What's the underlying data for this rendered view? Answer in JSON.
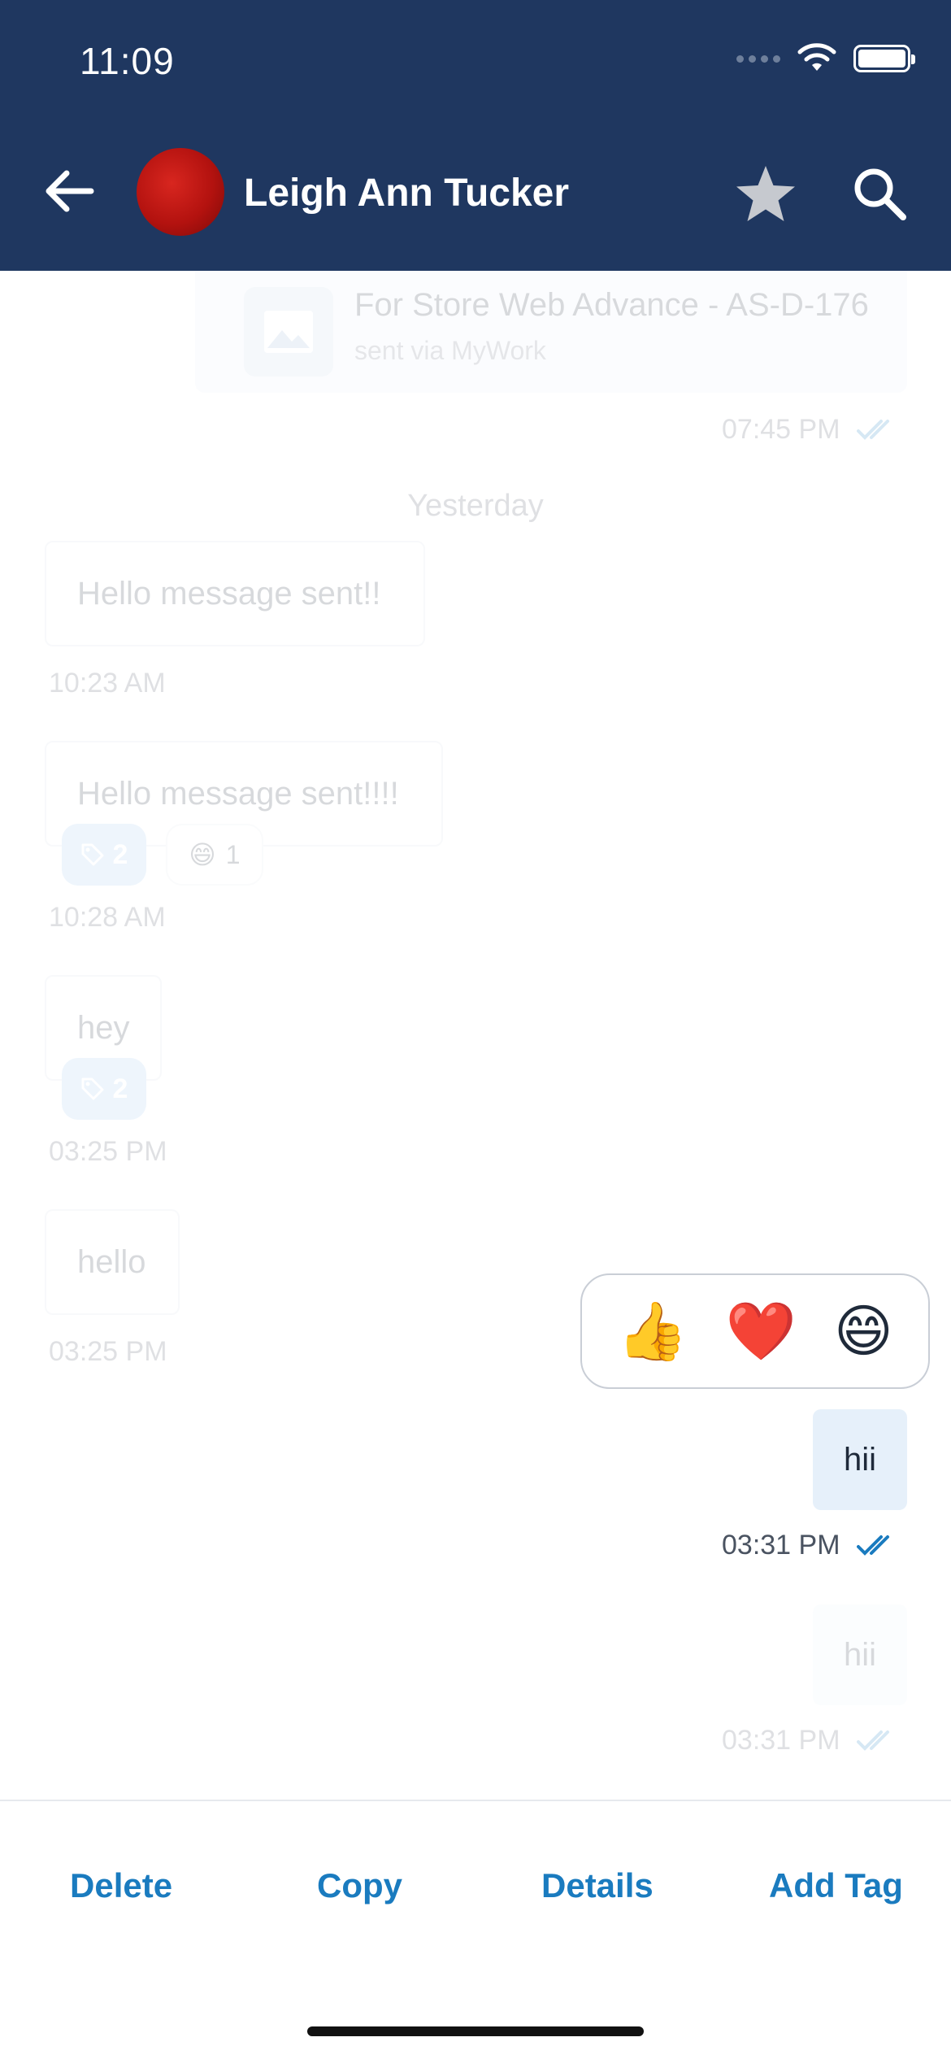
{
  "status_bar": {
    "time": "11:09"
  },
  "header": {
    "contact_name": "Leigh Ann Tucker"
  },
  "attachment": {
    "title": "For Store Web Advance - AS-D-176",
    "subtitle": "sent via MyWork",
    "time": "07:45 PM"
  },
  "date_separator": "Yesterday",
  "messages": [
    {
      "text": "Hello message sent!!",
      "time": "10:23 AM"
    },
    {
      "text": "Hello message sent!!!!",
      "time": "10:28 AM",
      "tag_count": "2",
      "reaction_emoji": "😄",
      "reaction_count": "1"
    },
    {
      "text": "hey",
      "time": "03:25 PM",
      "tag_count": "2"
    },
    {
      "text": "hello",
      "time": "03:25 PM"
    }
  ],
  "selected_message": {
    "text": "hii",
    "time": "03:31 PM"
  },
  "next_message": {
    "text": "hii",
    "time": "03:31 PM"
  },
  "reaction_picker": {
    "emojis": [
      "👍",
      "❤️",
      "😄"
    ]
  },
  "actions": {
    "delete": "Delete",
    "copy": "Copy",
    "details": "Details",
    "add_tag": "Add Tag"
  },
  "colors": {
    "header": "#1f3760",
    "action_text": "#1a7bbf",
    "read_check": "#1a7bbf",
    "outgoing_bubble": "#e6f0fa"
  },
  "icons": [
    "back-arrow-icon",
    "star-icon",
    "search-icon",
    "image-icon",
    "tag-icon",
    "double-check-icon",
    "wifi-icon",
    "battery-icon"
  ]
}
